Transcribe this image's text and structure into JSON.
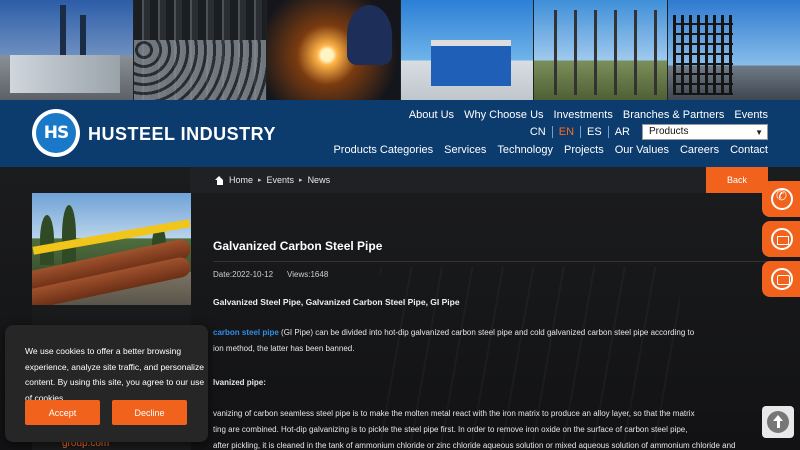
{
  "header": {
    "brand": "HUSTEEL INDUSTRY",
    "logo_mark": "HS",
    "nav_top": [
      "About Us",
      "Why Choose Us",
      "Investments",
      "Branches & Partners",
      "Events"
    ],
    "languages": [
      "CN",
      "EN",
      "ES",
      "AR"
    ],
    "active_language": "EN",
    "select_value": "Products",
    "nav_bottom": [
      "Products Categories",
      "Services",
      "Technology",
      "Projects",
      "Our Values",
      "Careers",
      "Contact"
    ]
  },
  "breadcrumb": {
    "items": [
      "Home",
      "Events",
      "News"
    ],
    "back_label": "Back"
  },
  "article": {
    "title": "Galvanized Carbon Steel Pipe",
    "date": "Date:2022-10-12",
    "views": "Views:1648",
    "tags": "Galvanized Steel Pipe, Galvanized Carbon Steel Pipe, GI Pipe",
    "para1_link": "carbon steel pipe",
    "para1_text": "(GI Pipe) can be divided into hot-dip galvanized carbon steel pipe and cold galvanized carbon steel pipe according to",
    "para1_line2": "ion method, the latter has been banned.",
    "heading2": "lvanized pipe:",
    "para2_line1": "vanizing of carbon seamless steel pipe is to make the molten metal react with the iron matrix to produce an alloy layer, so that the matrix",
    "para2_line2": "ting are combined. Hot-dip galvanizing is to pickle the steel pipe first. In order to remove iron oxide on the surface of carbon steel pipe,",
    "para2_line3": "after pickling, it is cleaned in the tank of ammonium chloride or zinc chloride aqueous solution or mixed aqueous solution of ammonium chloride and"
  },
  "sidebar": {
    "link_text": "group.com"
  },
  "cookie": {
    "text": "We use cookies to offer a better browsing experience, analyze site traffic, and personalize content. By using this site, you agree to our use of cookies.",
    "accept": "Accept",
    "decline": "Decline"
  },
  "colors": {
    "header_bg": "#0c3b6e",
    "accent": "#f1621d",
    "link": "#2e8fe8"
  },
  "icons": [
    "whatsapp-icon",
    "mail-icon",
    "chat-icon",
    "scroll-top-icon",
    "home-icon"
  ]
}
